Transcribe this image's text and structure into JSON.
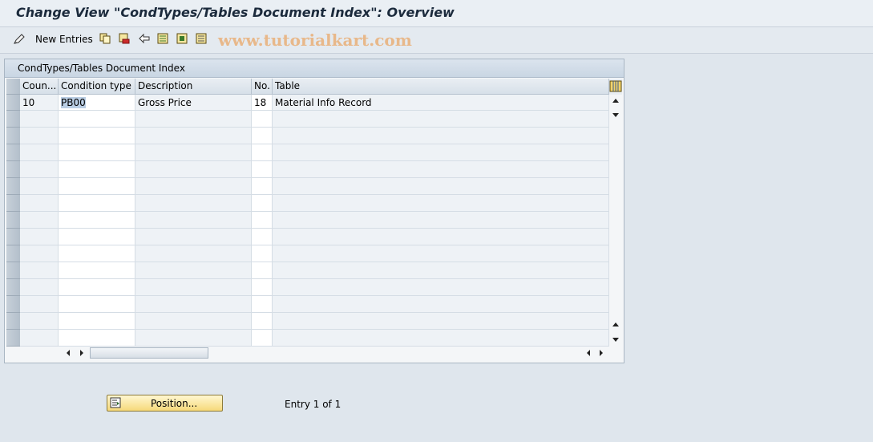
{
  "window": {
    "title": "Change View \"CondTypes/Tables Document Index\": Overview"
  },
  "toolbar": {
    "new_entries_label": "New Entries",
    "watermark": "www.tutorialkart.com"
  },
  "table": {
    "panel_title": "CondTypes/Tables Document Index",
    "columns": [
      "Coun...",
      "Condition type",
      "Description",
      "No.",
      "Table"
    ],
    "rows": [
      {
        "counter": "10",
        "condition_type": "PB00",
        "description": "Gross Price",
        "no": "18",
        "table": "Material Info Record"
      }
    ],
    "empty_rows": 14
  },
  "footer": {
    "position_label": "Position...",
    "entry_status": "Entry 1 of 1"
  },
  "colors": {
    "accent": "#f6d97a",
    "selection": "#b9cde3"
  }
}
